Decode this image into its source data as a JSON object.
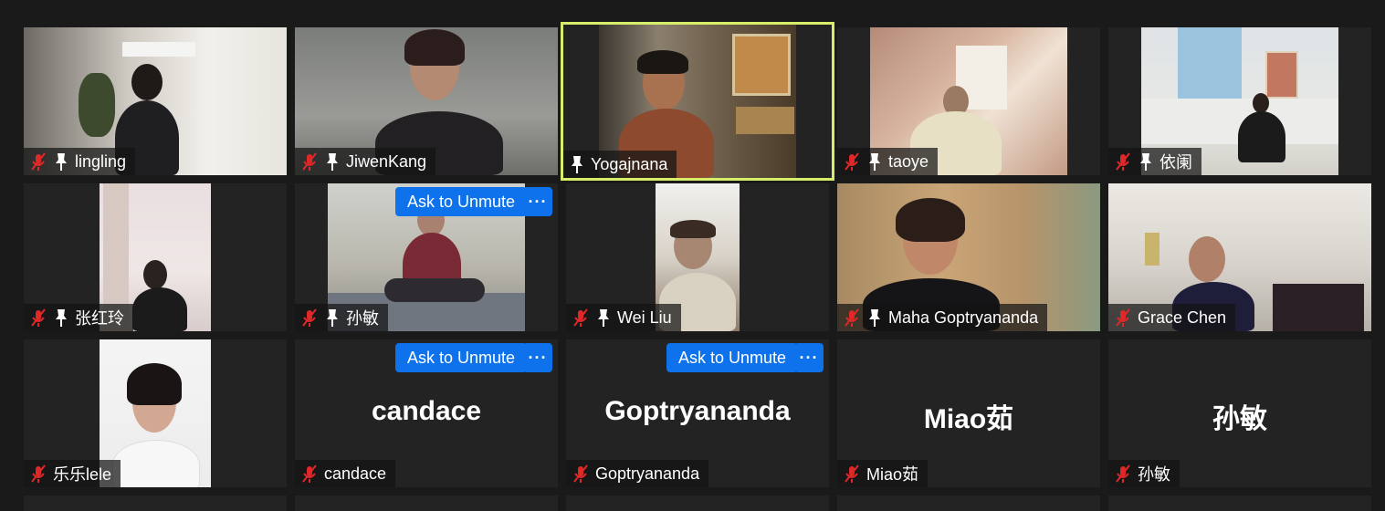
{
  "participants": [
    {
      "name": "lingling"
    },
    {
      "name": "JiwenKang"
    },
    {
      "name": "Yogajnana"
    },
    {
      "name": "taoye"
    },
    {
      "name": "依阑"
    },
    {
      "name": "张红玲"
    },
    {
      "name": "孙敏",
      "ask": "Ask to Unmute",
      "more": "···"
    },
    {
      "name": "Wei Liu"
    },
    {
      "name": "Maha Goptryananda"
    },
    {
      "name": "Grace Chen"
    },
    {
      "name": "乐乐lele"
    },
    {
      "name": "candace",
      "big": "candace",
      "ask": "Ask to Unmute",
      "more": "···"
    },
    {
      "name": "Goptryananda",
      "big": "Goptryananda",
      "ask": "Ask to Unmute",
      "more": "···"
    },
    {
      "name": "Miao茹",
      "big": "Miao茹"
    },
    {
      "name": "孙敏",
      "big": "孙敏"
    }
  ],
  "colors": {
    "background": "#1a1a1a",
    "tile": "#232323",
    "active_border": "#d7ee6a",
    "accent": "#0e72ed",
    "muted_icon": "#e02828"
  },
  "icons": {
    "mic_muted": "mic-muted-icon",
    "pin": "pin-icon"
  }
}
